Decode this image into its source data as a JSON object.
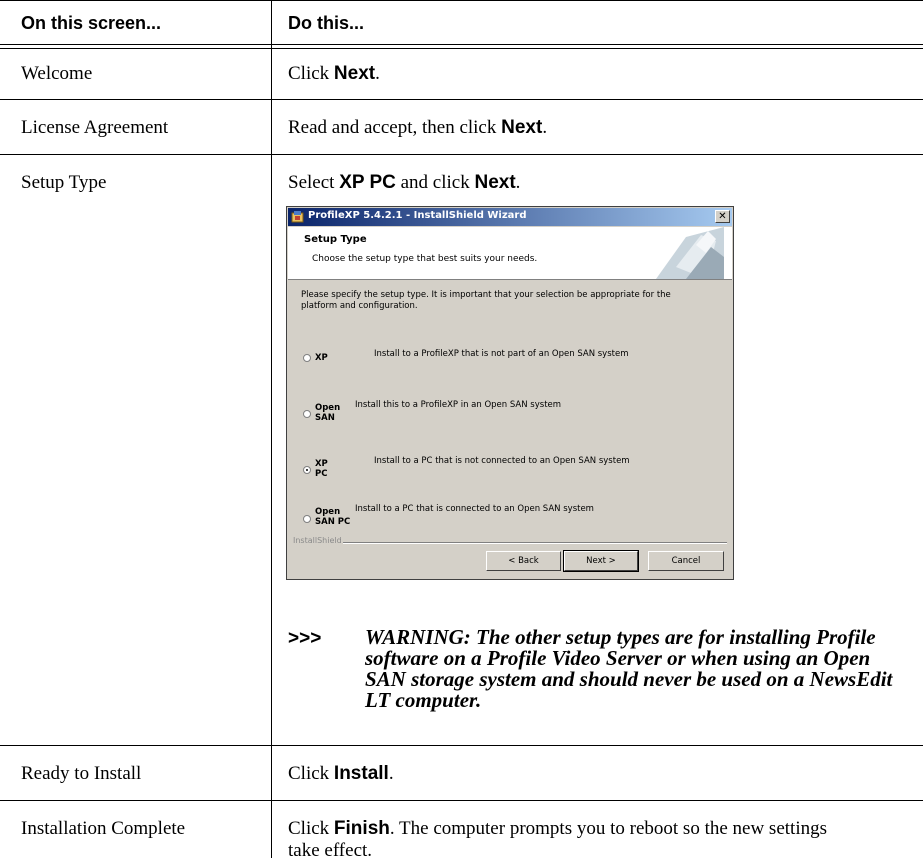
{
  "table": {
    "header": {
      "col1": "On this screen...",
      "col2": "Do this..."
    },
    "rows": [
      {
        "screen": "Welcome",
        "action_pre": "Click ",
        "action_bold": "Next",
        "action_post": "."
      },
      {
        "screen": "License Agreement",
        "action_pre": "Read and accept, then click ",
        "action_bold": "Next",
        "action_post": "."
      },
      {
        "screen": "Setup Type",
        "action_pre": "Select ",
        "action_bold": "XP PC",
        "action_mid": " and click ",
        "action_bold2": "Next",
        "action_post": "."
      },
      {
        "screen": "Ready to Install",
        "action_pre": "Click ",
        "action_bold": "Install",
        "action_post": "."
      },
      {
        "screen": "Installation Complete",
        "action_pre": "Click ",
        "action_bold": "Finish",
        "action_post": ". The computer prompts you to reboot so the new settings take effect."
      }
    ]
  },
  "dialog": {
    "title": "ProfileXP 5.4.2.1 - InstallShield Wizard",
    "banner_title": "Setup Type",
    "banner_subtitle": "Choose the setup type that best suits your needs.",
    "intro": "Please specify the setup type. It is important that your selection be appropriate for the platform and configuration.",
    "options": [
      {
        "label": "XP",
        "desc": "Install to a ProfileXP that is not part of an Open SAN system",
        "selected": false
      },
      {
        "label": "Open SAN",
        "desc": "Install this to a ProfileXP in an Open SAN system",
        "selected": false
      },
      {
        "label": "XP PC",
        "desc": "Install to a PC that is not connected to an Open SAN system",
        "selected": true
      },
      {
        "label": "Open SAN PC",
        "desc": "Install to a PC that is connected to an Open SAN system",
        "selected": false
      }
    ],
    "brand": "InstallShield",
    "buttons": {
      "back": "< Back",
      "next": "Next >",
      "cancel": "Cancel"
    },
    "close_symbol": "✕"
  },
  "warning": {
    "marker": ">>>",
    "text": "WARNING: The other setup types are for installing Profile software on a Profile Video Server or when using an Open SAN storage system and should never be used on a NewsEdit LT computer."
  },
  "icons": {
    "app": "installshield-app-icon",
    "close": "close-icon",
    "radio": "radio-button",
    "banner": "banner-art"
  }
}
